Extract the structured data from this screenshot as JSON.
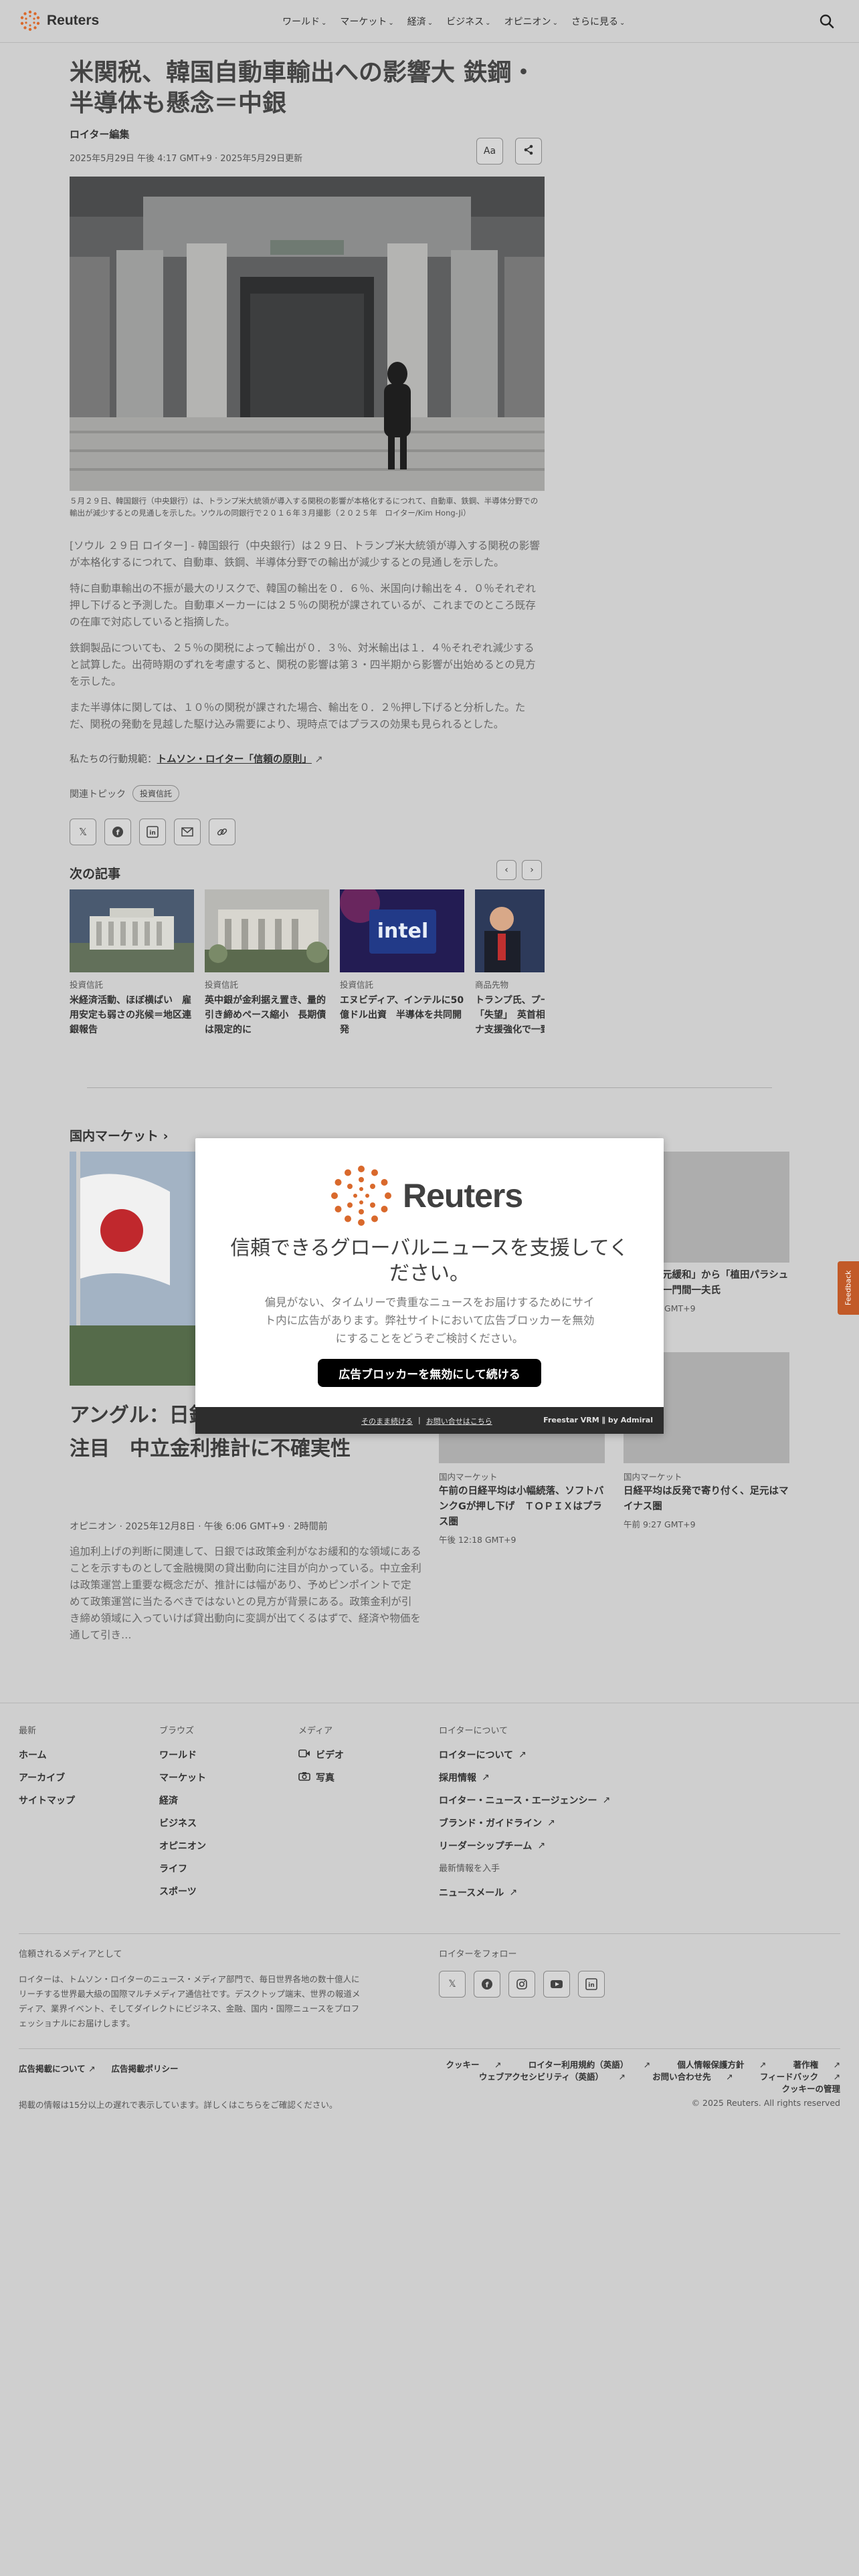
{
  "header": {
    "logo_text": "Reuters",
    "nav": [
      "ワールド",
      "マーケット",
      "経済",
      "ビジネス",
      "オピニオン",
      "さらに見る"
    ]
  },
  "article": {
    "title": "米関税、韓国自動車輸出への影響大 鉄鋼・半導体も懸念＝中銀",
    "byline": "ロイター編集",
    "dateline": "2025年5月29日 午後 4:17 GMT+9 · 2025年5月29日更新",
    "text_size_label": "Aa",
    "caption": "５月２９日、韓国銀行（中央銀行）は、トランプ米大統領が導入する関税の影響が本格化するにつれて、自動車、鉄鋼、半導体分野での輸出が減少するとの見通しを示した。ソウルの同銀行で２０１６年３月撮影（２０２５年　ロイター/Kim Hong-Ji）",
    "paragraphs": [
      "[ソウル ２９日 ロイター] - 韓国銀行（中央銀行）は２９日、トランプ米大統領が導入する関税の影響が本格化するにつれて、自動車、鉄鋼、半導体分野での輸出が減少するとの見通しを示した。",
      "特に自動車輸出の不振が最大のリスクで、韓国の輸出を０．６％、米国向け輸出を４．０％それぞれ押し下げると予測した。自動車メーカーには２５％の関税が課されているが、これまでのところ既存の在庫で対応していると指摘した。",
      "鉄鋼製品についても、２５％の関税によって輸出が０．３％、対米輸出は１．４％それぞれ減少すると試算した。出荷時期のずれを考慮すると、関税の影響は第３・四半期から影響が出始めるとの見方を示した。",
      "また半導体に関しては、１０％の関税が課された場合、輸出を０．２％押し下げると分析した。ただ、関税の発動を見越した駆け込み需要により、現時点ではプラスの効果も見られるとした。"
    ],
    "principles_prefix": "私たちの行動規範：",
    "principles_link": "トムソン・ロイター「信頼の原則」",
    "topics_label": "関連トピック",
    "topics": [
      "投資信託"
    ]
  },
  "next_articles": {
    "heading": "次の記事",
    "cards": [
      {
        "kicker": "投資信託",
        "title": "米経済活動、ほぼ横ばい　雇用安定も弱さの兆候＝地区連銀報告"
      },
      {
        "kicker": "投資信託",
        "title": "英中銀が金利据え置き、量的引き締めペース縮小　長期債は限定的に"
      },
      {
        "kicker": "投資信託",
        "title": "エヌビディア、インテルに50億ドル出資　半導体を共同開発"
      },
      {
        "kicker": "商品先物",
        "title": "トランプ氏、プーチン氏に「失望」　英首相とウクライナ支援強化で一致"
      }
    ]
  },
  "markets": {
    "heading": "国内マーケット",
    "lead": {
      "title": "アングル：日銀、秋以降の貸出動向に注目　中立金利推計に不確実性",
      "meta": "オピニオン · 2025年12月8日 · 午後 6:06 GMT+9 · 2時間前",
      "summary": "追加利上げの判断に関連して、日銀では政策金利がなお緩和的な領域にあることを示すものとして金融機関の貸出動向に注目が向かっている。中立金利は政策運営上重要な概念だが、推計には幅があり、予めピンポイントで定めて政策運営に当たるべきではないとの見方が背景にある。政策金利が引き締め領域に入っていけば貸出動向に変調が出てくるはずで、経済や物価を通して引き…"
    },
    "minis": [
      {
        "kicker": "国内マーケット",
        "title": "「超異次元緩和」から「植田パラシュート」へ一門間一夫氏",
        "time": "午後 6:00 GMT+9"
      },
      {
        "kicker": "国内マーケット",
        "title": "午前の日経平均は小幅続落、ソフトバンクGが押し下げ　ＴＯＰＩＸはプラス圏",
        "time": "午後 12:18 GMT+9"
      },
      {
        "kicker": "国内マーケット",
        "title": "日経平均は反発で寄り付く、足元はマイナス圏",
        "time": "午前 9:27 GMT+9"
      }
    ]
  },
  "modal": {
    "logo_text": "Reuters",
    "title": "信頼できるグローバルニュースを支援してください。",
    "text": "偏見がない、タイムリーで貴重なニュースをお届けするためにサイト内に広告があります。弊社サイトにおいて広告ブロッカーを無効にすることをどうぞご検討ください。",
    "button": "広告ブロッカーを無効にして続ける",
    "footer_link1": "そのまま続ける",
    "footer_sep": "|",
    "footer_link2": "お問い合せはこちら",
    "footer_brand": "Freestar VRM ∥ by Admiral"
  },
  "feedback": "Feedback",
  "footer": {
    "col1": {
      "heading": "最新",
      "items": [
        "ホーム",
        "アーカイブ",
        "サイトマップ"
      ]
    },
    "col2": {
      "heading": "ブラウズ",
      "items": [
        "ワールド",
        "マーケット",
        "経済",
        "ビジネス",
        "オピニオン",
        "ライフ",
        "スポーツ"
      ]
    },
    "col3": {
      "heading": "メディア",
      "items": [
        "ビデオ",
        "写真"
      ]
    },
    "col4": {
      "heading": "ロイターについて",
      "items": [
        "ロイターについて",
        "採用情報",
        "ロイター・ニュース・エージェンシー",
        "ブランド・ガイドライン",
        "リーダーシップチーム"
      ]
    },
    "col5": {
      "heading": "最新情報を入手",
      "items": [
        "ニュースメール"
      ]
    },
    "trusted_heading": "信頼されるメディアとして",
    "trusted_text": "ロイターは、トムソン・ロイターのニュース・メディア部門で、毎日世界各地の数十億人にリーチする世界最大級の国際マルチメディア通信社です。デスクトップ端末、世界の報道メディア、業界イベント、そしてダイレクトにビジネス、金融、国内・国際ニュースをプロフェッショナルにお届けします。",
    "follow_heading": "ロイターをフォロー",
    "legal_left": [
      "広告掲載について",
      "広告掲載ポリシー"
    ],
    "legal_right": [
      "クッキー",
      "ロイター利用規約（英語）",
      "個人情報保護方針",
      "著作権",
      "ウェブアクセシビリティ（英語）",
      "お問い合わせ先",
      "フィードバック",
      "クッキーの管理"
    ],
    "delay_note": "掲載の情報は15分以上の遅れで表示しています。詳しくはこちらをご確認ください。",
    "copyright": "© 2025 Reuters. All rights reserved"
  }
}
